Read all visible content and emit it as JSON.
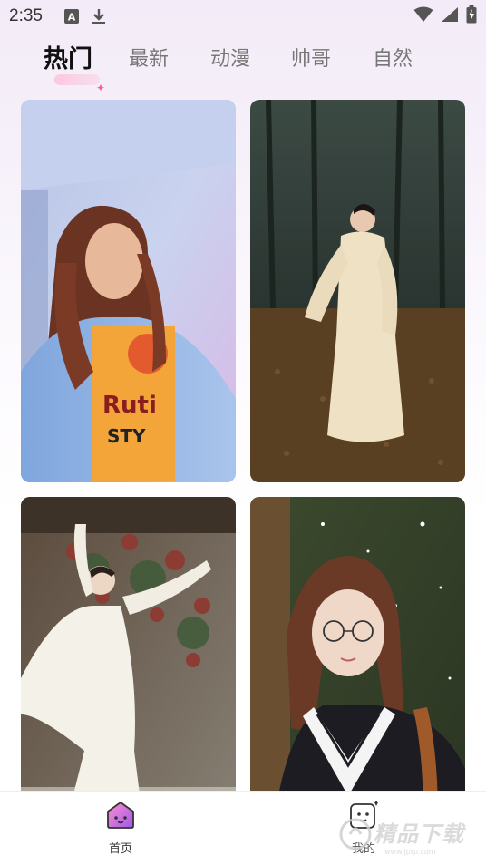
{
  "status_bar": {
    "time": "2:35",
    "icons": [
      "keyboard-a-icon",
      "download-icon",
      "wifi-icon",
      "signal-icon",
      "battery-charging-icon"
    ]
  },
  "tabs": [
    {
      "label": "热门",
      "active": true
    },
    {
      "label": "最新",
      "active": false
    },
    {
      "label": "动漫",
      "active": false
    },
    {
      "label": "帅哥",
      "active": false
    },
    {
      "label": "自然",
      "active": false
    }
  ],
  "wallpapers": [
    {
      "name": "wallpaper-girl-orange-tshirt"
    },
    {
      "name": "wallpaper-hanfu-forest"
    },
    {
      "name": "wallpaper-hanfu-dance"
    },
    {
      "name": "wallpaper-sailor-uniform-glasses"
    }
  ],
  "bottom_nav": {
    "home_label": "首页",
    "mine_label": "我的"
  },
  "watermark": {
    "text": "精品下载"
  },
  "colors": {
    "accent_pink": "#ff5aa0",
    "home_icon": "#c060e0",
    "active_tab": "#111111",
    "inactive_tab": "#777777"
  }
}
